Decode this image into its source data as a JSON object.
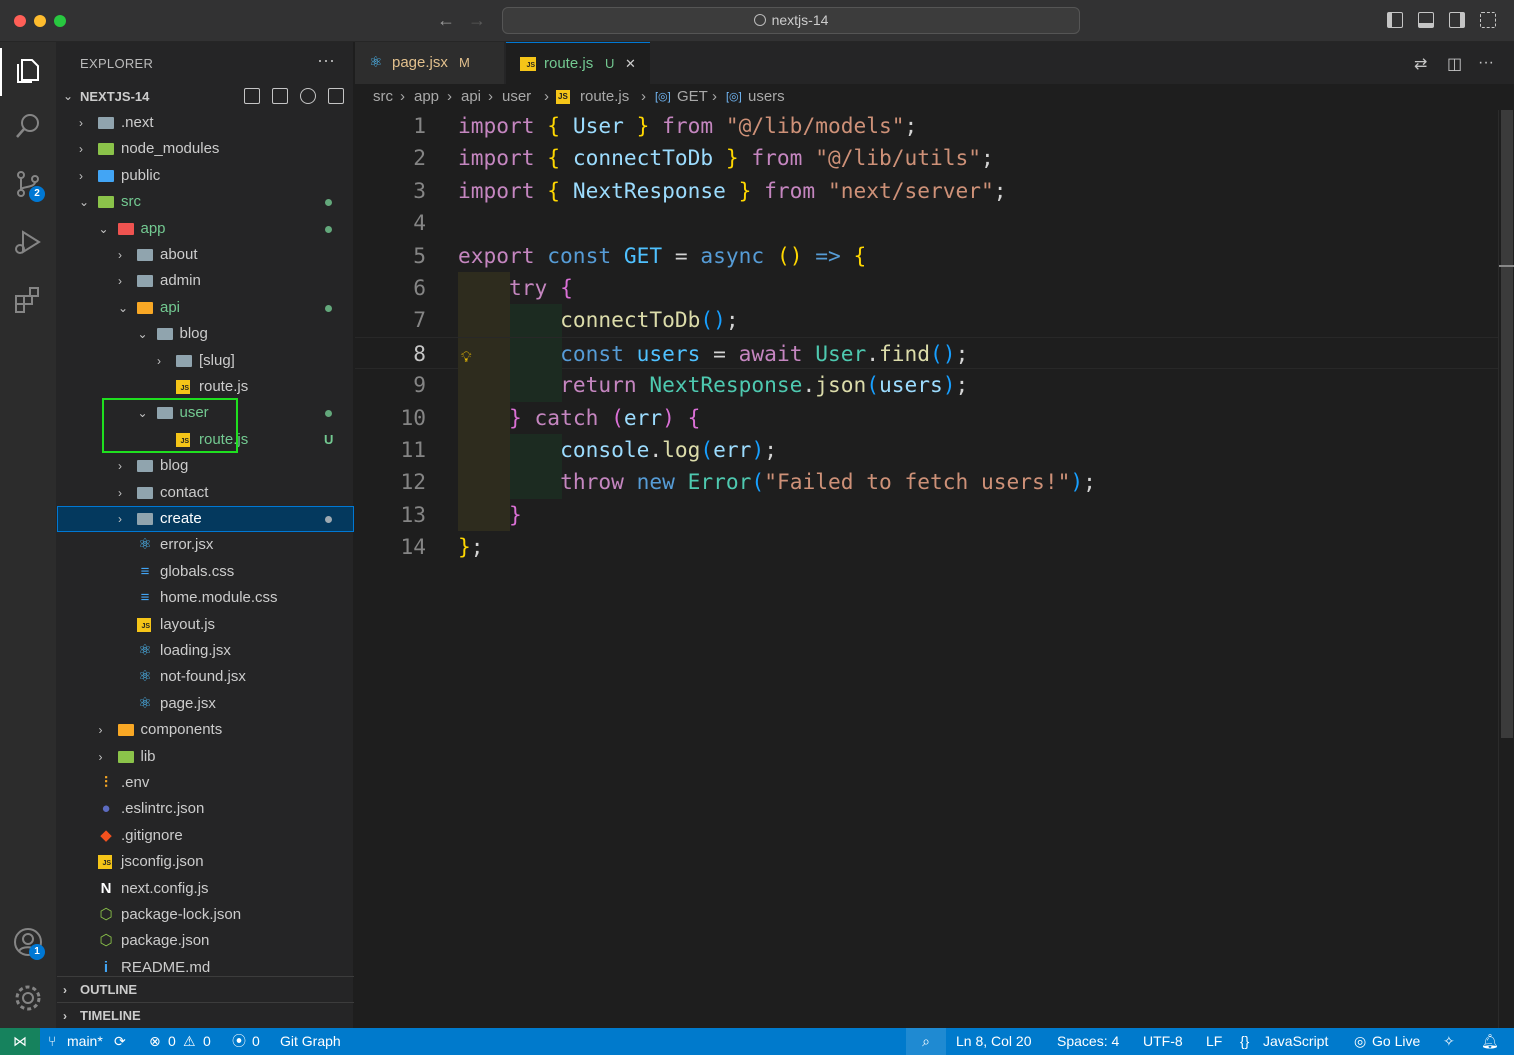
{
  "window": {
    "title": "nextjs-14"
  },
  "colors": {
    "accent": "#007acc",
    "highlight_box": "#1fe01f",
    "git_untracked": "#73c991"
  },
  "activity_bar": {
    "items": [
      {
        "name": "explorer-icon",
        "active": true
      },
      {
        "name": "search-icon"
      },
      {
        "name": "source-control-icon",
        "badge": "2"
      },
      {
        "name": "run-debug-icon"
      },
      {
        "name": "extensions-icon"
      }
    ],
    "accounts_badge": "1"
  },
  "sidebar": {
    "header": "EXPLORER",
    "more": "···",
    "project": "NEXTJS-14",
    "sections": {
      "outline": "OUTLINE",
      "timeline": "TIMELINE"
    },
    "tree": [
      {
        "label": ".next",
        "depth": 0,
        "kind": "folder",
        "chev": "›"
      },
      {
        "label": "node_modules",
        "depth": 0,
        "kind": "folder-green",
        "chev": "›"
      },
      {
        "label": "public",
        "depth": 0,
        "kind": "folder-blue",
        "chev": "›"
      },
      {
        "label": "src",
        "depth": 0,
        "kind": "folder-green",
        "chev": "⌄",
        "status": "dot",
        "color": "green"
      },
      {
        "label": "app",
        "depth": 1,
        "kind": "folder-red",
        "chev": "⌄",
        "status": "dot",
        "color": "green"
      },
      {
        "label": "about",
        "depth": 2,
        "kind": "folder",
        "chev": "›"
      },
      {
        "label": "admin",
        "depth": 2,
        "kind": "folder",
        "chev": "›"
      },
      {
        "label": "api",
        "depth": 2,
        "kind": "folder-yellow",
        "chev": "⌄",
        "status": "dot",
        "color": "green"
      },
      {
        "label": "blog",
        "depth": 3,
        "kind": "folder",
        "chev": "⌄"
      },
      {
        "label": "[slug]",
        "depth": 4,
        "kind": "folder",
        "chev": "›"
      },
      {
        "label": "route.js",
        "depth": 4,
        "kind": "js"
      },
      {
        "label": "user",
        "depth": 3,
        "kind": "folder",
        "chev": "⌄",
        "status": "dot",
        "color": "green"
      },
      {
        "label": "route.js",
        "depth": 4,
        "kind": "js",
        "status": "U",
        "color": "green"
      },
      {
        "label": "blog",
        "depth": 2,
        "kind": "folder",
        "chev": "›"
      },
      {
        "label": "contact",
        "depth": 2,
        "kind": "folder",
        "chev": "›"
      },
      {
        "label": "create",
        "depth": 2,
        "kind": "folder",
        "chev": "›",
        "status": "dot",
        "color": "white",
        "selected": true
      },
      {
        "label": "error.jsx",
        "depth": 2,
        "kind": "react"
      },
      {
        "label": "globals.css",
        "depth": 2,
        "kind": "css"
      },
      {
        "label": "home.module.css",
        "depth": 2,
        "kind": "css"
      },
      {
        "label": "layout.js",
        "depth": 2,
        "kind": "js"
      },
      {
        "label": "loading.jsx",
        "depth": 2,
        "kind": "react"
      },
      {
        "label": "not-found.jsx",
        "depth": 2,
        "kind": "react"
      },
      {
        "label": "page.jsx",
        "depth": 2,
        "kind": "react"
      },
      {
        "label": "components",
        "depth": 1,
        "kind": "folder-yellow",
        "chev": "›"
      },
      {
        "label": "lib",
        "depth": 1,
        "kind": "folder-green",
        "chev": "›"
      },
      {
        "label": ".env",
        "depth": 0,
        "kind": "env"
      },
      {
        "label": ".eslintrc.json",
        "depth": 0,
        "kind": "eslint"
      },
      {
        "label": ".gitignore",
        "depth": 0,
        "kind": "git"
      },
      {
        "label": "jsconfig.json",
        "depth": 0,
        "kind": "jsconfig"
      },
      {
        "label": "next.config.js",
        "depth": 0,
        "kind": "next"
      },
      {
        "label": "package-lock.json",
        "depth": 0,
        "kind": "npm"
      },
      {
        "label": "package.json",
        "depth": 0,
        "kind": "npm"
      },
      {
        "label": "README.md",
        "depth": 0,
        "kind": "info"
      }
    ]
  },
  "tabs": [
    {
      "label": "page.jsx",
      "mark": "M",
      "active": false
    },
    {
      "label": "route.js",
      "mark": "U",
      "active": true,
      "close": "✕"
    }
  ],
  "breadcrumbs": [
    "src",
    "app",
    "api",
    "user",
    "route.js",
    "GET",
    "users"
  ],
  "editor": {
    "current_line": 8,
    "lines": [
      {
        "n": "1",
        "tokens": [
          [
            "k",
            "import "
          ],
          [
            "y",
            "{ "
          ],
          [
            "v",
            "User"
          ],
          [
            "y",
            " }"
          ],
          [
            "k",
            " from "
          ],
          [
            "s",
            "\"@/lib/models\""
          ],
          [
            "p",
            ";"
          ]
        ]
      },
      {
        "n": "2",
        "tokens": [
          [
            "k",
            "import "
          ],
          [
            "y",
            "{ "
          ],
          [
            "v",
            "connectToDb"
          ],
          [
            "y",
            " }"
          ],
          [
            "k",
            " from "
          ],
          [
            "s",
            "\"@/lib/utils\""
          ],
          [
            "p",
            ";"
          ]
        ]
      },
      {
        "n": "3",
        "tokens": [
          [
            "k",
            "import "
          ],
          [
            "y",
            "{ "
          ],
          [
            "v",
            "NextResponse"
          ],
          [
            "y",
            " }"
          ],
          [
            "k",
            " from "
          ],
          [
            "s",
            "\"next/server\""
          ],
          [
            "p",
            ";"
          ]
        ]
      },
      {
        "n": "4",
        "tokens": []
      },
      {
        "n": "5",
        "tokens": [
          [
            "k",
            "export "
          ],
          [
            "kb",
            "const "
          ],
          [
            "cv",
            "GET"
          ],
          [
            "p",
            " = "
          ],
          [
            "kb",
            "async "
          ],
          [
            "y",
            "()"
          ],
          [
            "kb",
            " => "
          ],
          [
            "y",
            "{"
          ]
        ]
      },
      {
        "n": "6",
        "tokens": [
          [
            "p",
            "    "
          ],
          [
            "k",
            "try "
          ],
          [
            "pk",
            "{"
          ]
        ]
      },
      {
        "n": "7",
        "tokens": [
          [
            "p",
            "        "
          ],
          [
            "f",
            "connectToDb"
          ],
          [
            "bl",
            "()"
          ],
          [
            "p",
            ";"
          ]
        ]
      },
      {
        "n": "8",
        "tokens": [
          [
            "p",
            "        "
          ],
          [
            "kb",
            "const "
          ],
          [
            "cv",
            "users"
          ],
          [
            "p",
            " = "
          ],
          [
            "k",
            "await "
          ],
          [
            "t",
            "User"
          ],
          [
            "p",
            "."
          ],
          [
            "f",
            "find"
          ],
          [
            "bl",
            "()"
          ],
          [
            "p",
            ";"
          ]
        ]
      },
      {
        "n": "9",
        "tokens": [
          [
            "p",
            "        "
          ],
          [
            "k",
            "return "
          ],
          [
            "t",
            "NextResponse"
          ],
          [
            "p",
            "."
          ],
          [
            "f",
            "json"
          ],
          [
            "bl",
            "("
          ],
          [
            "v",
            "users"
          ],
          [
            "bl",
            ")"
          ],
          [
            "p",
            ";"
          ]
        ]
      },
      {
        "n": "10",
        "tokens": [
          [
            "p",
            "    "
          ],
          [
            "pk",
            "}"
          ],
          [
            "k",
            " catch "
          ],
          [
            "pk",
            "("
          ],
          [
            "v",
            "err"
          ],
          [
            "pk",
            ")"
          ],
          [
            "pk",
            " {"
          ]
        ]
      },
      {
        "n": "11",
        "tokens": [
          [
            "p",
            "        "
          ],
          [
            "v",
            "console"
          ],
          [
            "p",
            "."
          ],
          [
            "f",
            "log"
          ],
          [
            "bl",
            "("
          ],
          [
            "v",
            "err"
          ],
          [
            "bl",
            ")"
          ],
          [
            "p",
            ";"
          ]
        ]
      },
      {
        "n": "12",
        "tokens": [
          [
            "p",
            "        "
          ],
          [
            "k",
            "throw "
          ],
          [
            "kb",
            "new "
          ],
          [
            "t",
            "Error"
          ],
          [
            "bl",
            "("
          ],
          [
            "s",
            "\"Failed to fetch users!\""
          ],
          [
            "bl",
            ")"
          ],
          [
            "p",
            ";"
          ]
        ]
      },
      {
        "n": "13",
        "tokens": [
          [
            "p",
            "    "
          ],
          [
            "pk",
            "}"
          ]
        ]
      },
      {
        "n": "14",
        "tokens": [
          [
            "y",
            "}"
          ],
          [
            "p",
            ";"
          ]
        ]
      }
    ]
  },
  "statusbar": {
    "branch": "main*",
    "errors": "0",
    "warnings": "0",
    "ports": "0",
    "git_graph": "Git Graph",
    "position": "Ln 8, Col 20",
    "spaces": "Spaces: 4",
    "encoding": "UTF-8",
    "eol": "LF",
    "language": "JavaScript",
    "go_live": "Go Live"
  }
}
